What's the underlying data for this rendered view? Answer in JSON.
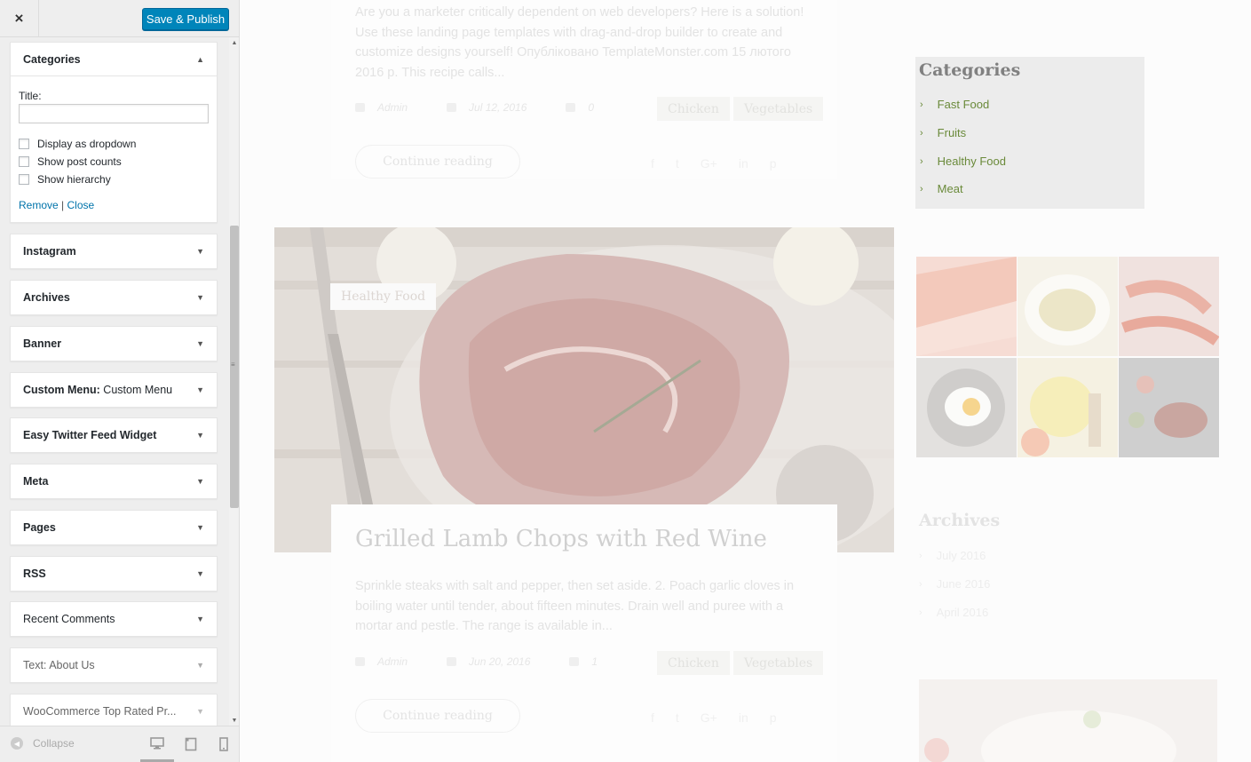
{
  "topbar": {
    "close_label": "×",
    "publish_label": "Save & Publish"
  },
  "categories_widget": {
    "title": "Categories",
    "title_field_label": "Title:",
    "title_value": "",
    "checkboxes": [
      "Display as dropdown",
      "Show post counts",
      "Show hierarchy"
    ],
    "remove_label": "Remove",
    "separator": "|",
    "close_label": "Close"
  },
  "widgets": [
    {
      "name": "Instagram",
      "sub": ""
    },
    {
      "name": "Archives",
      "sub": ""
    },
    {
      "name": "Banner",
      "sub": ""
    },
    {
      "name": "Custom Menu:",
      "sub": "Custom Menu"
    },
    {
      "name": "Easy Twitter Feed Widget",
      "sub": ""
    },
    {
      "name": "Meta",
      "sub": ""
    },
    {
      "name": "Pages",
      "sub": ""
    },
    {
      "name": "RSS",
      "sub": ""
    },
    {
      "name": "Recent Comments",
      "sub": ""
    },
    {
      "name": "Text:",
      "sub": "About Us"
    },
    {
      "name": "WooCommerce Top Rated Pr...",
      "sub": ""
    }
  ],
  "footer": {
    "collapse_label": "Collapse"
  },
  "preview": {
    "post1": {
      "excerpt": "Are you a marketer critically dependent on web developers? Here is a solution! Use these landing page templates with drag-and-drop builder to create and customize designs yourself! Опубліковано TemplateMonster.com 15 лютого 2016 р. This recipe calls...",
      "author": "Admin",
      "date": "Jul 12, 2016",
      "comments": "0",
      "tags": [
        "Chicken",
        "Vegetables"
      ],
      "continue_label": "Continue reading"
    },
    "post2": {
      "category": "Healthy Food",
      "title": "Grilled Lamb Chops with Red Wine",
      "excerpt": "Sprinkle steaks with salt and pepper, then set aside. 2. Poach garlic cloves in boiling water until tender, about fifteen minutes. Drain well and puree with a mortar and pestle. The range is available in...",
      "author": "Admin",
      "date": "Jun 20, 2016",
      "comments": "1",
      "tags": [
        "Chicken",
        "Vegetables"
      ],
      "continue_label": "Continue reading"
    },
    "categories": {
      "title": "Categories",
      "items": [
        "Fast Food",
        "Fruits",
        "Healthy Food",
        "Meat"
      ]
    },
    "archives": {
      "title": "Archives",
      "items": [
        "July 2016",
        "June 2016",
        "April 2016"
      ]
    }
  }
}
